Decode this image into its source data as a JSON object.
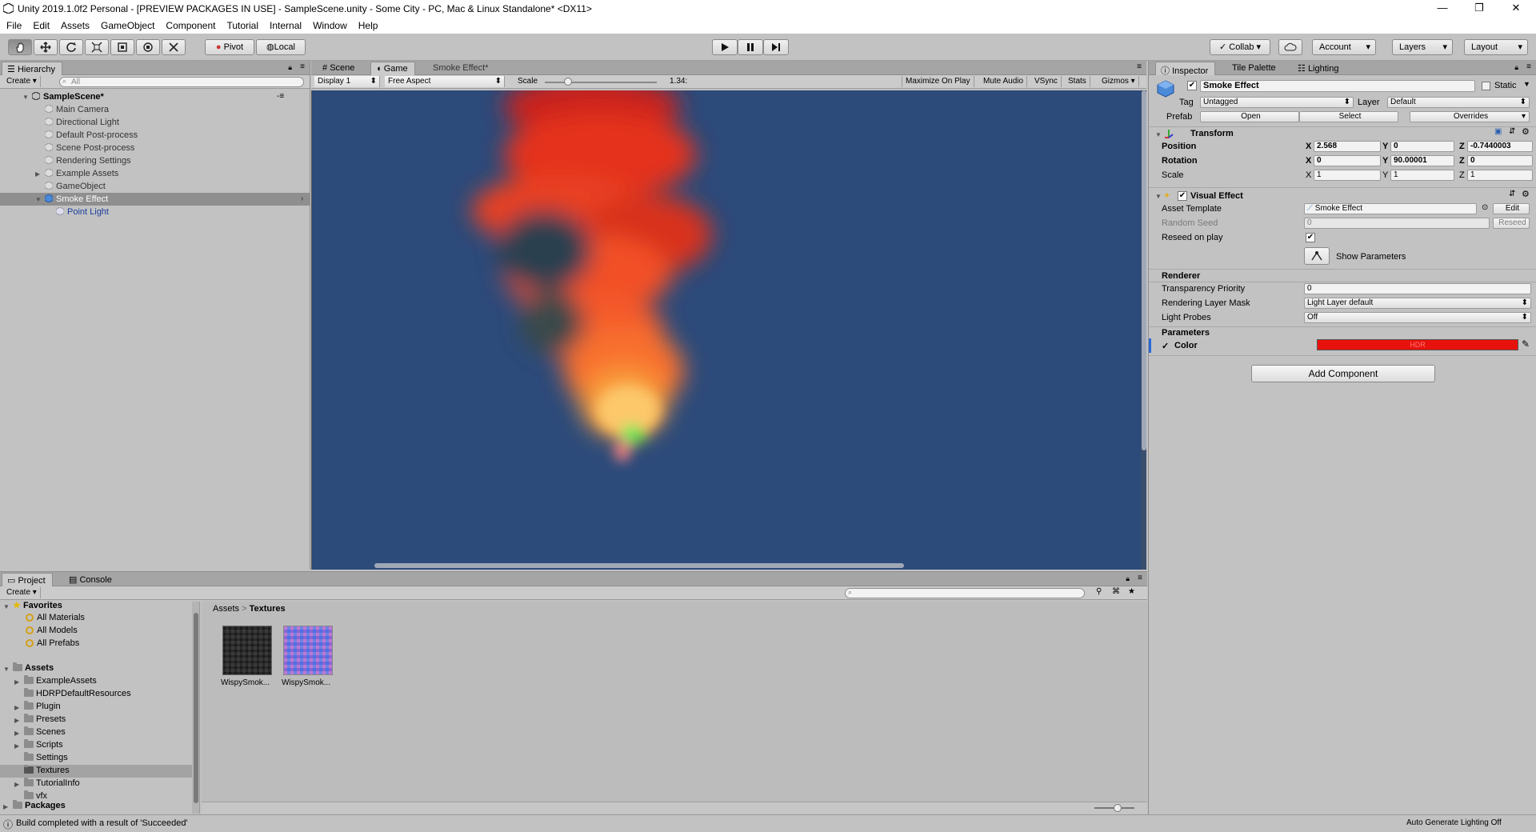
{
  "window": {
    "title": "Unity 2019.1.0f2 Personal - [PREVIEW PACKAGES IN USE] - SampleScene.unity - Some City - PC, Mac & Linux Standalone* <DX11>",
    "minimize": "—",
    "maximize": "❐",
    "close": "✕"
  },
  "menu": [
    "File",
    "Edit",
    "Assets",
    "GameObject",
    "Component",
    "Tutorial",
    "Internal",
    "Window",
    "Help"
  ],
  "toolbar": {
    "pivot": "Pivot",
    "local": "Local",
    "collab": "Collab",
    "account": "Account",
    "layers": "Layers",
    "layout": "Layout"
  },
  "hierarchy": {
    "tab": "Hierarchy",
    "create": "Create",
    "search_placeholder": "All",
    "scene": "SampleScene*",
    "items": [
      "Main Camera",
      "Directional Light",
      "Default Post-process",
      "Scene Post-process",
      "Rendering Settings",
      "Example Assets",
      "GameObject",
      "Smoke Effect",
      "Point Light"
    ]
  },
  "game": {
    "tabs": [
      "Scene",
      "Game",
      "Smoke Effect*"
    ],
    "display": "Display 1",
    "aspect": "Free Aspect",
    "scale_label": "Scale",
    "scale_value": "1.34:",
    "toggles": [
      "Maximize On Play",
      "Mute Audio",
      "VSync",
      "Stats",
      "Gizmos"
    ],
    "background": "#2c4a7a"
  },
  "inspector": {
    "tabs": [
      "Inspector",
      "Tile Palette",
      "Lighting"
    ],
    "object_name": "Smoke Effect",
    "static_label": "Static",
    "tag_label": "Tag",
    "tag_value": "Untagged",
    "layer_label": "Layer",
    "layer_value": "Default",
    "prefab_label": "Prefab",
    "prefab_open": "Open",
    "prefab_select": "Select",
    "prefab_overrides": "Overrides",
    "transform": {
      "title": "Transform",
      "position_label": "Position",
      "px": "2.568",
      "py": "0",
      "pz": "-0.7440003",
      "rotation_label": "Rotation",
      "rx": "0",
      "ry": "90.00001",
      "rz": "0",
      "scale_label": "Scale",
      "sx": "1",
      "sy": "1",
      "sz": "1",
      "x": "X",
      "y": "Y",
      "z": "Z"
    },
    "vfx": {
      "title": "Visual Effect",
      "asset_template_label": "Asset Template",
      "asset_template_value": "Smoke Effect",
      "edit": "Edit",
      "random_seed_label": "Random Seed",
      "random_seed_value": "0",
      "reseed": "Reseed",
      "reseed_on_play_label": "Reseed on play",
      "show_params": "Show Parameters"
    },
    "renderer": {
      "title": "Renderer",
      "transparency_label": "Transparency Priority",
      "transparency_value": "0",
      "layer_mask_label": "Rendering Layer Mask",
      "layer_mask_value": "Light Layer default",
      "light_probes_label": "Light Probes",
      "light_probes_value": "Off"
    },
    "parameters": {
      "title": "Parameters",
      "color_label": "Color",
      "color_check": "✓",
      "hdr": "HDR",
      "color_value": "#e8120c"
    },
    "add_component": "Add Component"
  },
  "project": {
    "tabs": [
      "Project",
      "Console"
    ],
    "create": "Create",
    "favorites_label": "Favorites",
    "favorites": [
      "All Materials",
      "All Models",
      "All Prefabs"
    ],
    "assets_label": "Assets",
    "folders": [
      "ExampleAssets",
      "HDRPDefaultResources",
      "Plugin",
      "Presets",
      "Scenes",
      "Scripts",
      "Settings",
      "Textures",
      "TutorialInfo",
      "vfx"
    ],
    "packages_label": "Packages",
    "breadcrumb_root": "Assets",
    "breadcrumb_sep": ">",
    "breadcrumb_current": "Textures",
    "files": [
      "WispySmok...",
      "WispySmok..."
    ]
  },
  "status": {
    "message": "Build completed with a result of 'Succeeded'",
    "right": "Auto Generate Lighting Off"
  }
}
